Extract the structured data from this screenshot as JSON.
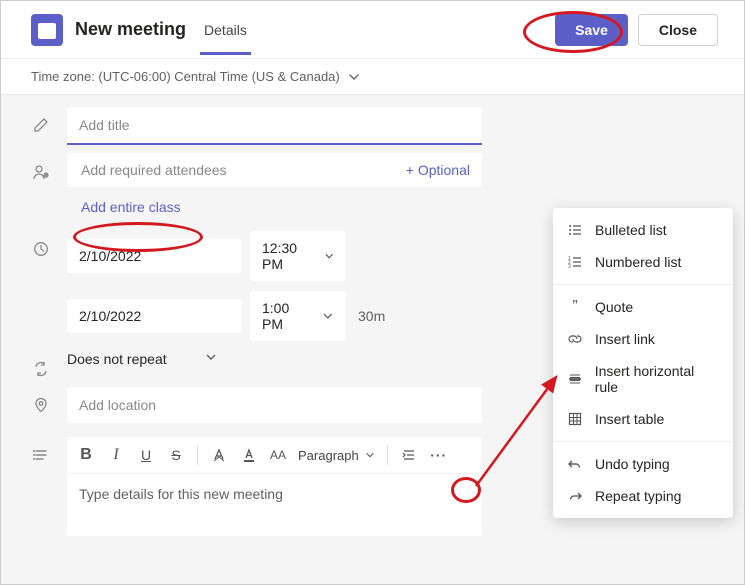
{
  "header": {
    "title": "New meeting",
    "tab": "Details",
    "save": "Save",
    "close": "Close"
  },
  "timezone": {
    "label": "Time zone: (UTC-06:00) Central Time (US & Canada)"
  },
  "fields": {
    "title_placeholder": "Add title",
    "attendees_placeholder": "Add required attendees",
    "optional": "+ Optional",
    "add_class": "Add entire class",
    "start_date": "2/10/2022",
    "start_time": "12:30 PM",
    "end_date": "2/10/2022",
    "end_time": "1:00 PM",
    "duration": "30m",
    "repeat": "Does not repeat",
    "location_placeholder": "Add location",
    "paragraph": "Paragraph",
    "description_placeholder": "Type details for this new meeting"
  },
  "rt_labels": {
    "bold": "B",
    "italic": "I",
    "underline": "U",
    "strike": "S",
    "fontsize": "AA"
  },
  "menu": {
    "bulleted": "Bulleted list",
    "numbered": "Numbered list",
    "quote": "Quote",
    "link": "Insert link",
    "hr": "Insert horizontal rule",
    "table": "Insert table",
    "undo": "Undo typing",
    "redo": "Repeat typing"
  }
}
